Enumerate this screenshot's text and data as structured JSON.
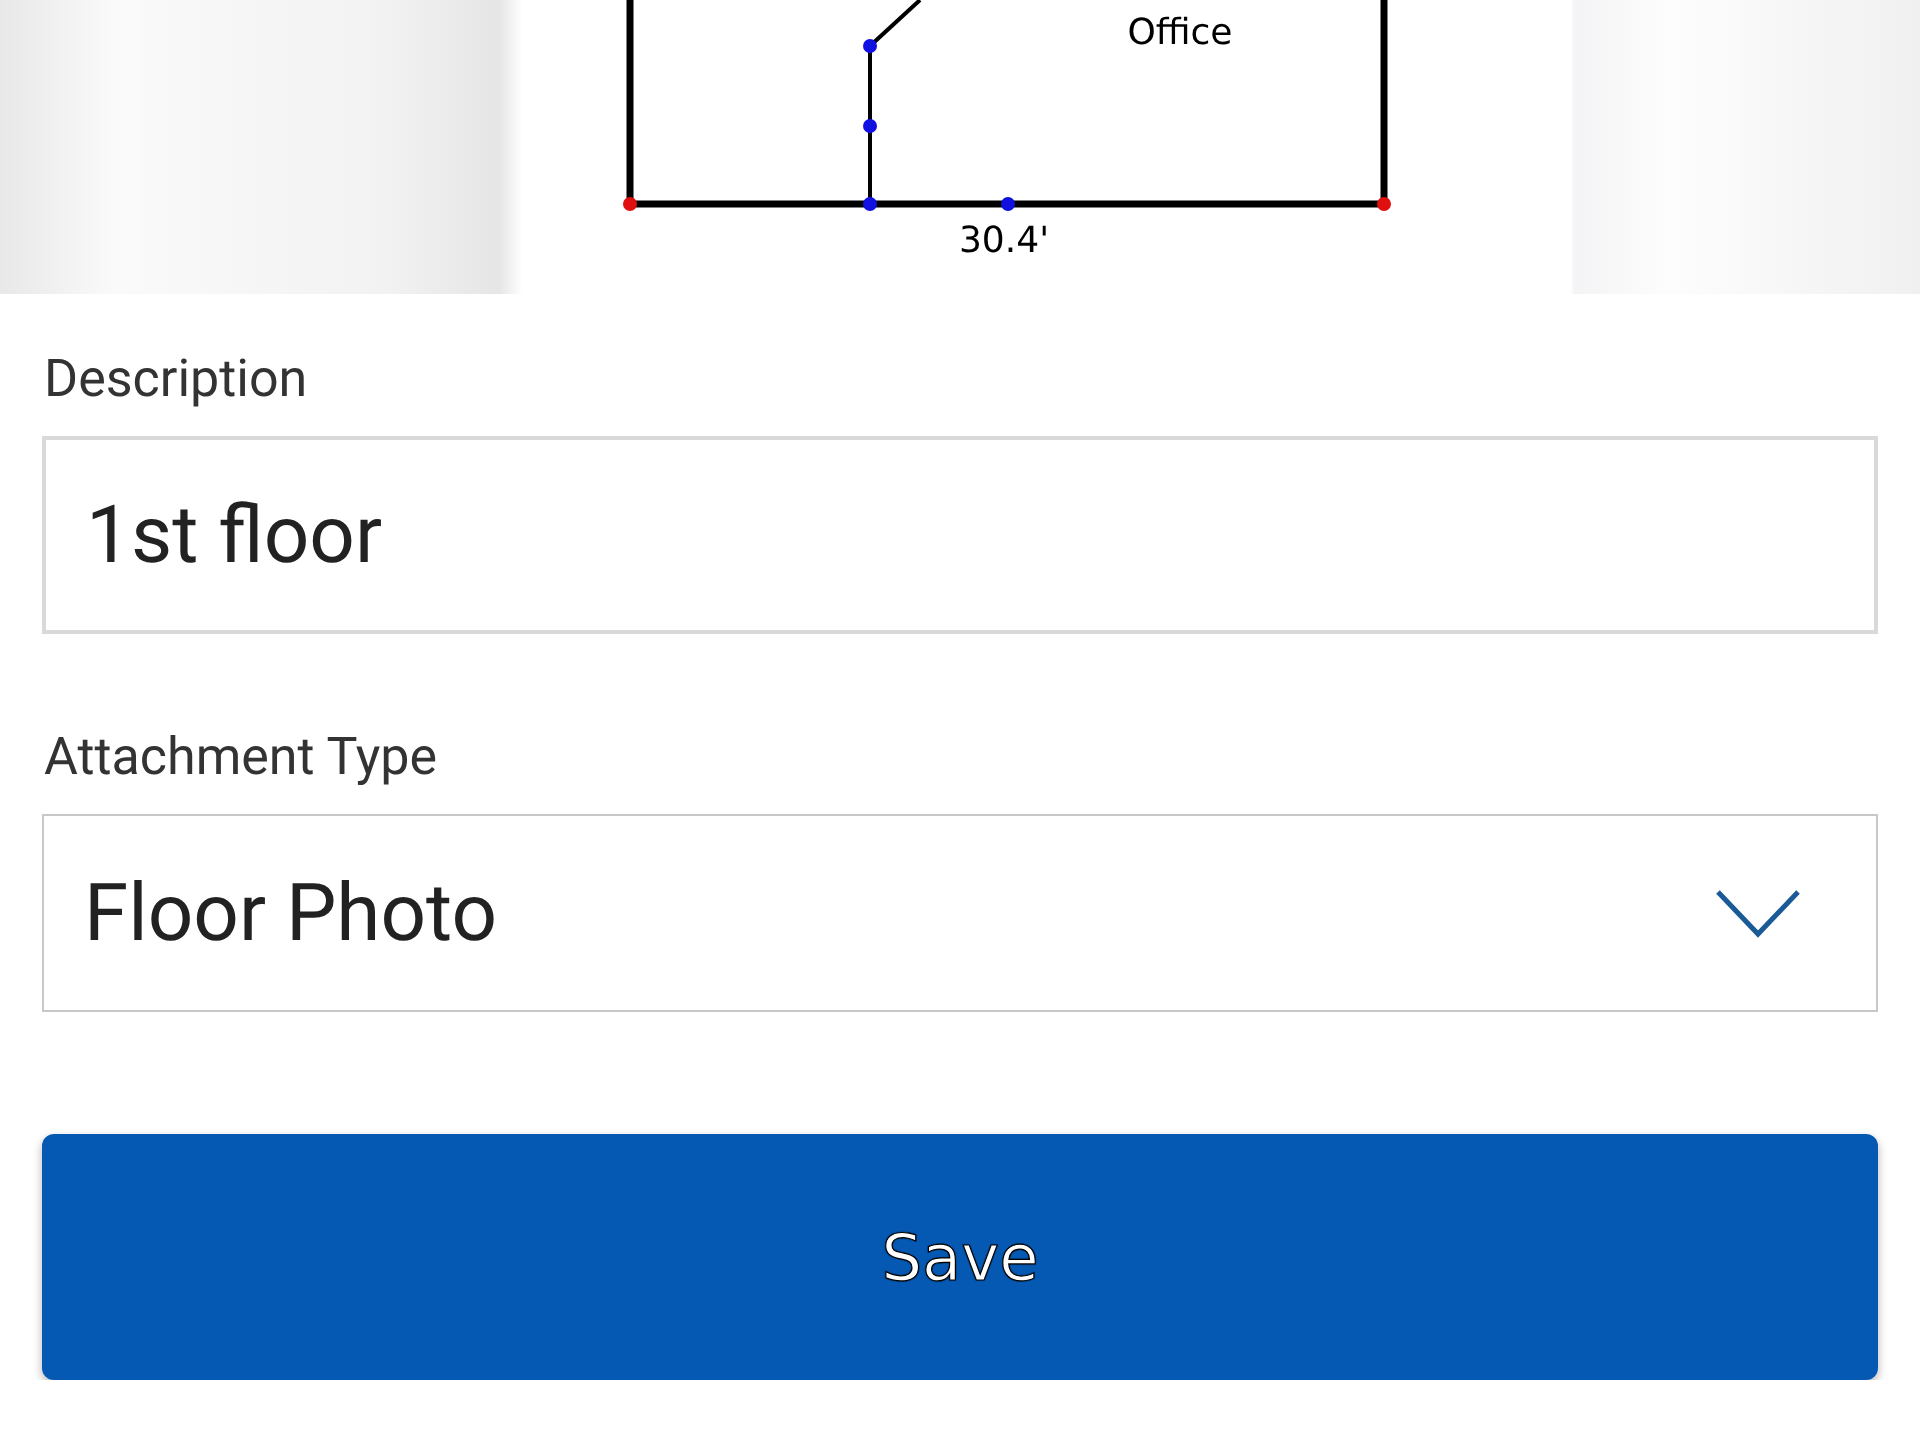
{
  "floor_plan": {
    "room_label": "Office",
    "dimension_label": "30.4'"
  },
  "description": {
    "label": "Description",
    "value": "1st floor"
  },
  "attachment_type": {
    "label": "Attachment Type",
    "value": "Floor Photo"
  },
  "save_button": {
    "label": "Save"
  }
}
